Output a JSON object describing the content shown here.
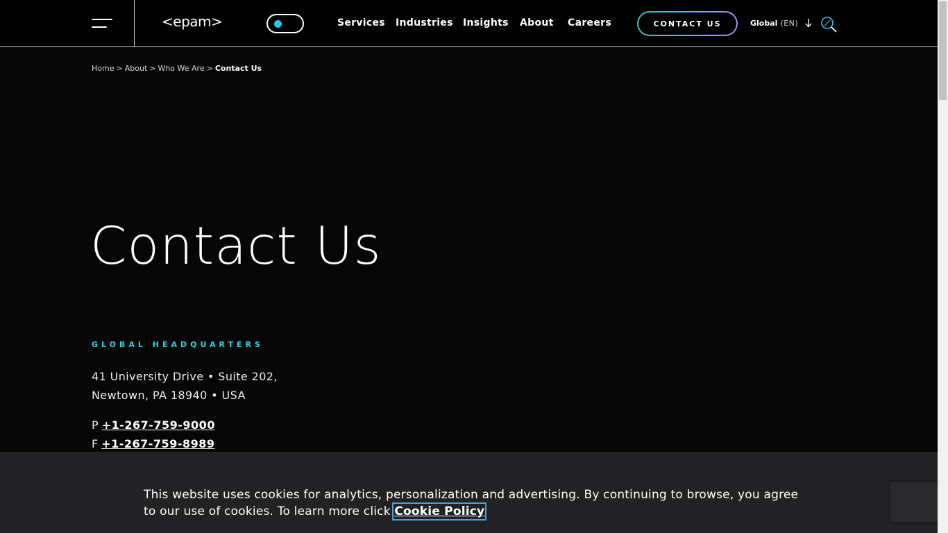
{
  "header": {
    "logo_text": "<epam>",
    "nav": [
      "Services",
      "Industries",
      "Insights",
      "About",
      "Careers"
    ],
    "contact_button": "CONTACT US",
    "language": {
      "name": "Global",
      "code": "(EN)"
    },
    "accent_color": "#2ac7e8"
  },
  "breadcrumb": {
    "items": [
      "Home",
      "About",
      "Who We Are"
    ],
    "separator": ">",
    "current": "Contact Us"
  },
  "main": {
    "title": "Contact Us",
    "hq": {
      "heading": "GLOBAL HEADQUARTERS",
      "address_line1": "41 University Drive • Suite 202,",
      "address_line2": "Newtown, PA 18940 • USA",
      "phone_prefix": "P",
      "phone": "+1-267-759-9000",
      "fax_prefix": "F",
      "fax": "+1-267-759-8989"
    }
  },
  "cookie_banner": {
    "text": "This website uses cookies for analytics, personalization and advertising. By continuing to browse, you agree to our use of cookies. To learn more click ",
    "link": "Cookie Policy"
  },
  "icons": {
    "menu": "hamburger-icon",
    "theme": "theme-toggle-icon",
    "language_arrow": "arrow-down-icon",
    "search": "search-icon"
  }
}
